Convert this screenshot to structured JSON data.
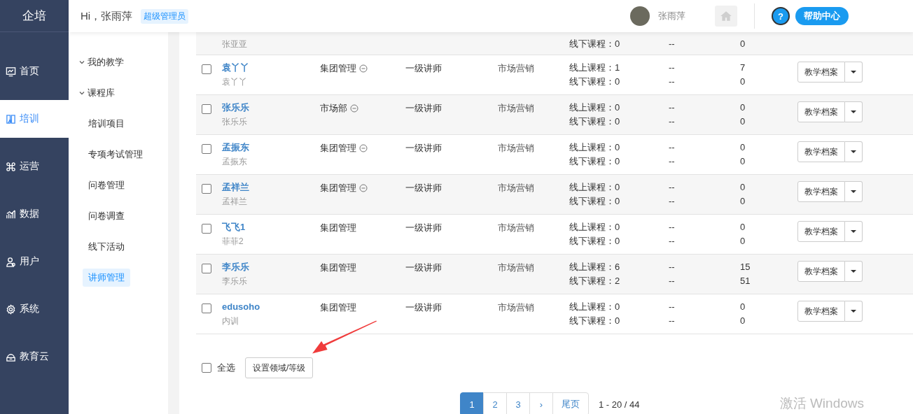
{
  "app": {
    "logo": "企培"
  },
  "header": {
    "greeting": "Hi，张雨萍",
    "role_badge": "超级管理员",
    "user_name": "张雨萍",
    "help_label": "帮助中心",
    "help_icon": "?"
  },
  "main_nav": [
    {
      "label": "首页",
      "selected": false
    },
    {
      "label": "培训",
      "selected": true
    },
    {
      "label": "运营",
      "selected": false
    },
    {
      "label": "数据",
      "selected": false
    },
    {
      "label": "用户",
      "selected": false
    },
    {
      "label": "系统",
      "selected": false
    },
    {
      "label": "教育云",
      "selected": false
    }
  ],
  "sub_nav": [
    {
      "kind": "group",
      "label": "我的教学",
      "expanded": true,
      "selected": false
    },
    {
      "kind": "group",
      "label": "课程库",
      "expanded": true,
      "selected": false
    },
    {
      "kind": "item",
      "label": "培训项目",
      "selected": false
    },
    {
      "kind": "item",
      "label": "专项考试管理",
      "selected": false
    },
    {
      "kind": "item",
      "label": "问卷管理",
      "selected": false
    },
    {
      "kind": "item",
      "label": "问卷调查",
      "selected": false
    },
    {
      "kind": "item",
      "label": "线下活动",
      "selected": false
    },
    {
      "kind": "item",
      "label": "讲师管理",
      "selected": true
    }
  ],
  "table": {
    "partial_row": {
      "sub": "张亚亚",
      "offline": "线下课程：0",
      "dash_2": "--",
      "count_2": "0"
    },
    "rows": [
      {
        "checked": false,
        "name": "袁丫丫",
        "sub": "袁丫丫",
        "dept": "集团管理",
        "dept_icon": true,
        "level": "一级讲师",
        "field": "市场营销",
        "online": "线上课程：1",
        "offline": "线下课程：0",
        "dash_1": "--",
        "dash_2": "--",
        "count_1": "7",
        "count_2": "0",
        "action": "教学档案"
      },
      {
        "checked": false,
        "name": "张乐乐",
        "sub": "张乐乐",
        "dept": "市场部",
        "dept_icon": true,
        "level": "一级讲师",
        "field": "市场营销",
        "online": "线上课程：0",
        "offline": "线下课程：0",
        "dash_1": "--",
        "dash_2": "--",
        "count_1": "0",
        "count_2": "0",
        "action": "教学档案"
      },
      {
        "checked": false,
        "name": "孟振东",
        "sub": "孟振东",
        "dept": "集团管理",
        "dept_icon": true,
        "level": "一级讲师",
        "field": "市场营销",
        "online": "线上课程：0",
        "offline": "线下课程：0",
        "dash_1": "--",
        "dash_2": "--",
        "count_1": "0",
        "count_2": "0",
        "action": "教学档案"
      },
      {
        "checked": false,
        "name": "孟祥兰",
        "sub": "孟祥兰",
        "dept": "集团管理",
        "dept_icon": true,
        "level": "一级讲师",
        "field": "市场营销",
        "online": "线上课程：0",
        "offline": "线下课程：0",
        "dash_1": "--",
        "dash_2": "--",
        "count_1": "0",
        "count_2": "0",
        "action": "教学档案"
      },
      {
        "checked": false,
        "name": "飞飞1",
        "sub": "菲菲2",
        "dept": "集团管理",
        "dept_icon": false,
        "level": "一级讲师",
        "field": "市场营销",
        "online": "线上课程：0",
        "offline": "线下课程：0",
        "dash_1": "--",
        "dash_2": "--",
        "count_1": "0",
        "count_2": "0",
        "action": "教学档案"
      },
      {
        "checked": false,
        "name": "李乐乐",
        "sub": "李乐乐",
        "dept": "集团管理",
        "dept_icon": false,
        "level": "一级讲师",
        "field": "市场营销",
        "online": "线上课程：6",
        "offline": "线下课程：2",
        "dash_1": "--",
        "dash_2": "--",
        "count_1": "15",
        "count_2": "51",
        "action": "教学档案"
      },
      {
        "checked": false,
        "name": "edusoho",
        "sub": "内训",
        "dept": "集团管理",
        "dept_icon": false,
        "level": "一级讲师",
        "field": "市场营销",
        "online": "线上课程：0",
        "offline": "线下课程：0",
        "dash_1": "--",
        "dash_2": "--",
        "count_1": "0",
        "count_2": "0",
        "action": "教学档案"
      }
    ]
  },
  "footer": {
    "select_all": {
      "label": "全选",
      "checked": false
    },
    "bulk_button": "设置领域/等级"
  },
  "pagination": {
    "pages": [
      {
        "label": "1",
        "selected": true
      },
      {
        "label": "2",
        "selected": false
      },
      {
        "label": "3",
        "selected": false
      }
    ],
    "next": "›",
    "last": "尾页",
    "range": "1 - 20 / 44"
  },
  "os_watermark": "激活 Windows"
}
